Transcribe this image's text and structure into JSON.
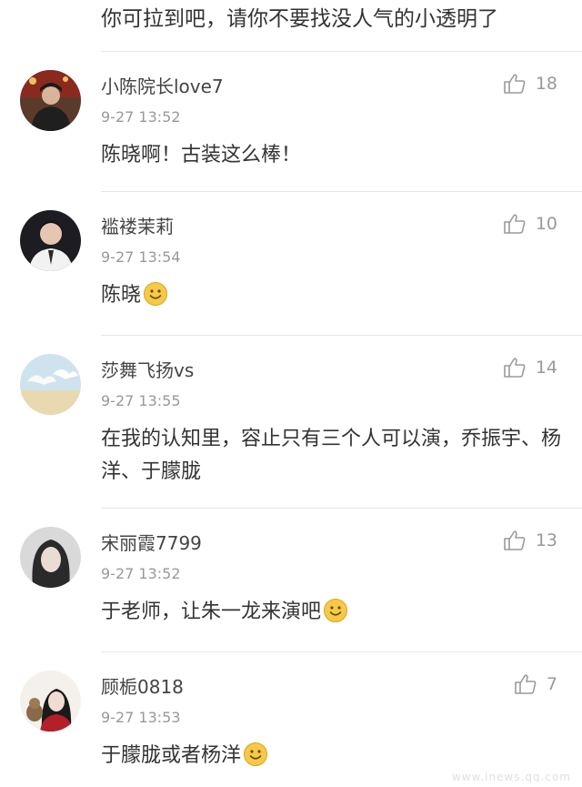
{
  "top_comment_tail": "你可拉到吧，请你不要找没人气的小透明了",
  "comments": [
    {
      "user": "小陈院长love7",
      "time": "9-27 13:52",
      "likes": "18",
      "text": "陈晓啊！古装这么棒！",
      "emoji": false
    },
    {
      "user": "褴褛茉莉",
      "time": "9-27 13:54",
      "likes": "10",
      "text": "陈晓",
      "emoji": true
    },
    {
      "user": "莎舞飞扬vs",
      "time": "9-27 13:55",
      "likes": "14",
      "text": "在我的认知里，容止只有三个人可以演，乔振宇、杨洋、于朦胧",
      "emoji": false
    },
    {
      "user": "宋丽霞7799",
      "time": "9-27 13:52",
      "likes": "13",
      "text": "于老师，让朱一龙来演吧",
      "emoji": true
    },
    {
      "user": "顾栀0818",
      "time": "9-27 13:53",
      "likes": "7",
      "text": "于朦胧或者杨洋",
      "emoji": true
    }
  ],
  "watermark": "www.inews.qq.com",
  "colors": {
    "text": "#333333",
    "meta": "#999999",
    "divider": "#e6e6e6",
    "emoji": "#f7c948"
  },
  "icons": {
    "like": "thumbs-up-icon",
    "emoji": "smile-emoji-icon"
  }
}
